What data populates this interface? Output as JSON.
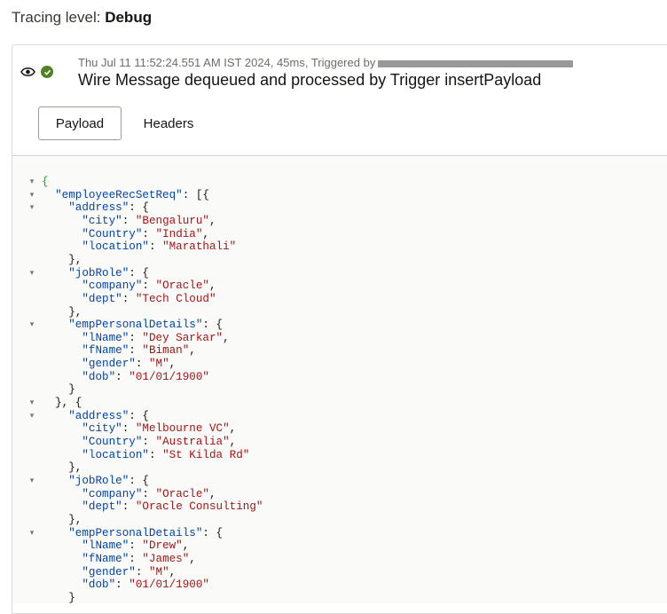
{
  "tracing": {
    "label": "Tracing level:",
    "value": "Debug"
  },
  "event": {
    "meta": "Thu Jul 11 11:52:24.551 AM IST 2024, 45ms, Triggered by",
    "message": "Wire Message dequeued and processed by Trigger insertPayload"
  },
  "tabs": {
    "payload": "Payload",
    "headers": "Headers"
  },
  "code_lines": [
    {
      "fold": true,
      "segs": [
        [
          "b",
          "{"
        ]
      ]
    },
    {
      "fold": true,
      "segs": [
        [
          "p",
          "  "
        ],
        [
          "k",
          "\"employeeRecSetReq\""
        ],
        [
          "p",
          ": [{"
        ]
      ]
    },
    {
      "fold": true,
      "segs": [
        [
          "p",
          "    "
        ],
        [
          "k",
          "\"address\""
        ],
        [
          "p",
          ": {"
        ]
      ]
    },
    {
      "fold": false,
      "segs": [
        [
          "p",
          "      "
        ],
        [
          "k",
          "\"city\""
        ],
        [
          "p",
          ": "
        ],
        [
          "s",
          "\"Bengaluru\""
        ],
        [
          "p",
          ","
        ]
      ]
    },
    {
      "fold": false,
      "segs": [
        [
          "p",
          "      "
        ],
        [
          "k",
          "\"Country\""
        ],
        [
          "p",
          ": "
        ],
        [
          "s",
          "\"India\""
        ],
        [
          "p",
          ","
        ]
      ]
    },
    {
      "fold": false,
      "segs": [
        [
          "p",
          "      "
        ],
        [
          "k",
          "\"location\""
        ],
        [
          "p",
          ": "
        ],
        [
          "s",
          "\"Marathali\""
        ]
      ]
    },
    {
      "fold": false,
      "segs": [
        [
          "p",
          "    },"
        ]
      ]
    },
    {
      "fold": true,
      "segs": [
        [
          "p",
          "    "
        ],
        [
          "k",
          "\"jobRole\""
        ],
        [
          "p",
          ": {"
        ]
      ]
    },
    {
      "fold": false,
      "segs": [
        [
          "p",
          "      "
        ],
        [
          "k",
          "\"company\""
        ],
        [
          "p",
          ": "
        ],
        [
          "s",
          "\"Oracle\""
        ],
        [
          "p",
          ","
        ]
      ]
    },
    {
      "fold": false,
      "segs": [
        [
          "p",
          "      "
        ],
        [
          "k",
          "\"dept\""
        ],
        [
          "p",
          ": "
        ],
        [
          "s",
          "\"Tech Cloud\""
        ]
      ]
    },
    {
      "fold": false,
      "segs": [
        [
          "p",
          "    },"
        ]
      ]
    },
    {
      "fold": true,
      "segs": [
        [
          "p",
          "    "
        ],
        [
          "k",
          "\"empPersonalDetails\""
        ],
        [
          "p",
          ": {"
        ]
      ]
    },
    {
      "fold": false,
      "segs": [
        [
          "p",
          "      "
        ],
        [
          "k",
          "\"lName\""
        ],
        [
          "p",
          ": "
        ],
        [
          "s",
          "\"Dey Sarkar\""
        ],
        [
          "p",
          ","
        ]
      ]
    },
    {
      "fold": false,
      "segs": [
        [
          "p",
          "      "
        ],
        [
          "k",
          "\"fName\""
        ],
        [
          "p",
          ": "
        ],
        [
          "s",
          "\"Biman\""
        ],
        [
          "p",
          ","
        ]
      ]
    },
    {
      "fold": false,
      "segs": [
        [
          "p",
          "      "
        ],
        [
          "k",
          "\"gender\""
        ],
        [
          "p",
          ": "
        ],
        [
          "s",
          "\"M\""
        ],
        [
          "p",
          ","
        ]
      ]
    },
    {
      "fold": false,
      "segs": [
        [
          "p",
          "      "
        ],
        [
          "k",
          "\"dob\""
        ],
        [
          "p",
          ": "
        ],
        [
          "s",
          "\"01/01/1900\""
        ]
      ]
    },
    {
      "fold": false,
      "segs": [
        [
          "p",
          "    }"
        ]
      ]
    },
    {
      "fold": true,
      "segs": [
        [
          "p",
          "  }, {"
        ]
      ]
    },
    {
      "fold": true,
      "segs": [
        [
          "p",
          "    "
        ],
        [
          "k",
          "\"address\""
        ],
        [
          "p",
          ": {"
        ]
      ]
    },
    {
      "fold": false,
      "segs": [
        [
          "p",
          "      "
        ],
        [
          "k",
          "\"city\""
        ],
        [
          "p",
          ": "
        ],
        [
          "s",
          "\"Melbourne VC\""
        ],
        [
          "p",
          ","
        ]
      ]
    },
    {
      "fold": false,
      "segs": [
        [
          "p",
          "      "
        ],
        [
          "k",
          "\"Country\""
        ],
        [
          "p",
          ": "
        ],
        [
          "s",
          "\"Australia\""
        ],
        [
          "p",
          ","
        ]
      ]
    },
    {
      "fold": false,
      "segs": [
        [
          "p",
          "      "
        ],
        [
          "k",
          "\"location\""
        ],
        [
          "p",
          ": "
        ],
        [
          "s",
          "\"St Kilda Rd\""
        ]
      ]
    },
    {
      "fold": false,
      "segs": [
        [
          "p",
          "    },"
        ]
      ]
    },
    {
      "fold": true,
      "segs": [
        [
          "p",
          "    "
        ],
        [
          "k",
          "\"jobRole\""
        ],
        [
          "p",
          ": {"
        ]
      ]
    },
    {
      "fold": false,
      "segs": [
        [
          "p",
          "      "
        ],
        [
          "k",
          "\"company\""
        ],
        [
          "p",
          ": "
        ],
        [
          "s",
          "\"Oracle\""
        ],
        [
          "p",
          ","
        ]
      ]
    },
    {
      "fold": false,
      "segs": [
        [
          "p",
          "      "
        ],
        [
          "k",
          "\"dept\""
        ],
        [
          "p",
          ": "
        ],
        [
          "s",
          "\"Oracle Consulting\""
        ]
      ]
    },
    {
      "fold": false,
      "segs": [
        [
          "p",
          "    },"
        ]
      ]
    },
    {
      "fold": true,
      "segs": [
        [
          "p",
          "    "
        ],
        [
          "k",
          "\"empPersonalDetails\""
        ],
        [
          "p",
          ": {"
        ]
      ]
    },
    {
      "fold": false,
      "segs": [
        [
          "p",
          "      "
        ],
        [
          "k",
          "\"lName\""
        ],
        [
          "p",
          ": "
        ],
        [
          "s",
          "\"Drew\""
        ],
        [
          "p",
          ","
        ]
      ]
    },
    {
      "fold": false,
      "segs": [
        [
          "p",
          "      "
        ],
        [
          "k",
          "\"fName\""
        ],
        [
          "p",
          ": "
        ],
        [
          "s",
          "\"James\""
        ],
        [
          "p",
          ","
        ]
      ]
    },
    {
      "fold": false,
      "segs": [
        [
          "p",
          "      "
        ],
        [
          "k",
          "\"gender\""
        ],
        [
          "p",
          ": "
        ],
        [
          "s",
          "\"M\""
        ],
        [
          "p",
          ","
        ]
      ]
    },
    {
      "fold": false,
      "segs": [
        [
          "p",
          "      "
        ],
        [
          "k",
          "\"dob\""
        ],
        [
          "p",
          ": "
        ],
        [
          "s",
          "\"01/01/1900\""
        ]
      ]
    },
    {
      "fold": false,
      "segs": [
        [
          "p",
          "    }"
        ]
      ]
    }
  ]
}
